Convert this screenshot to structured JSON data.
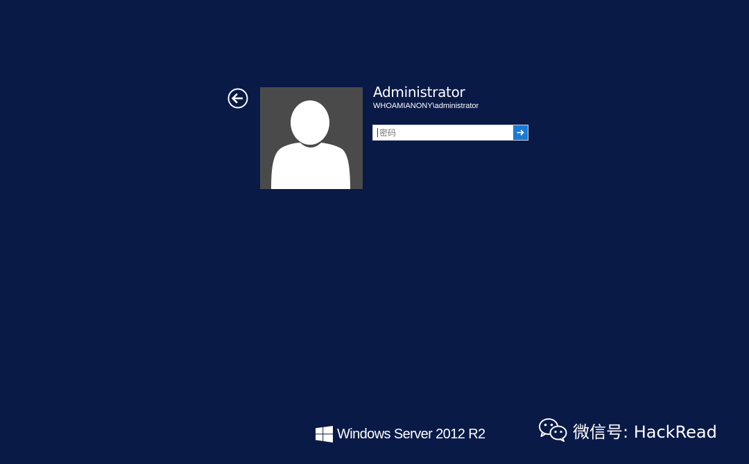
{
  "login": {
    "back_icon": "arrow-left-circle-icon",
    "avatar_icon": "default-user-silhouette",
    "user_display_name": "Administrator",
    "user_account": "WHOAMIANONY\\administrator",
    "password_placeholder": "密码",
    "password_value": "",
    "submit_icon": "arrow-right-icon"
  },
  "branding": {
    "logo_icon": "windows-logo-icon",
    "os_name": "Windows Server 2012 R2"
  },
  "watermark": {
    "icon": "wechat-icon",
    "text": "微信号: HackRead"
  },
  "colors": {
    "background": "#0a1a47",
    "avatar_tile": "#4a4a4a",
    "submit_accent": "#1a7bd4",
    "text": "#ffffff"
  }
}
